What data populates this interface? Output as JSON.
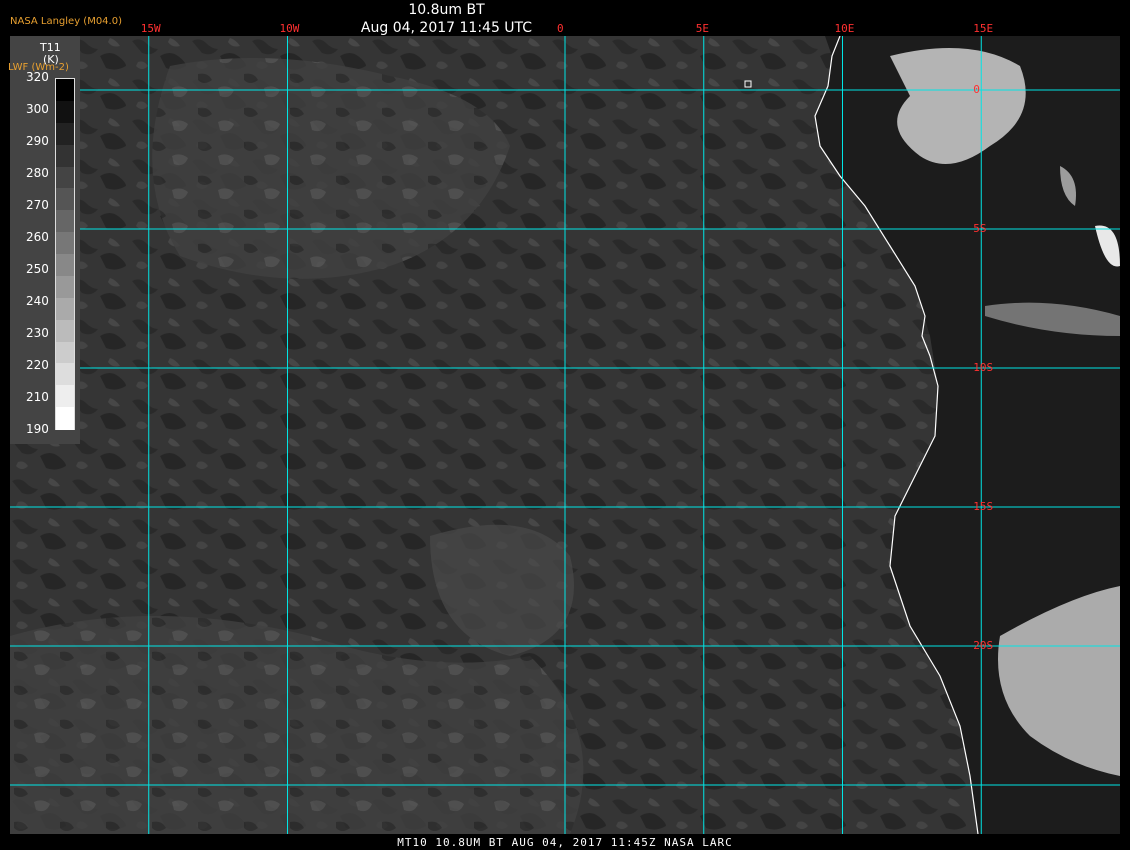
{
  "header": {
    "credit": "NASA Langley (M04.0)",
    "title": "10.8um BT",
    "subtitle": "Aug 04, 2017 11:45 UTC"
  },
  "grid": {
    "color": "#00e5e5",
    "label_color": "#ff3030",
    "longitudes": [
      {
        "label": "15W",
        "value": -15
      },
      {
        "label": "10W",
        "value": -10
      },
      {
        "label": "0",
        "value": 0
      },
      {
        "label": "5E",
        "value": 5
      },
      {
        "label": "10E",
        "value": 10
      },
      {
        "label": "15E",
        "value": 15
      }
    ],
    "latitudes": [
      {
        "label": "0",
        "value": 0
      },
      {
        "label": "5S",
        "value": -5
      },
      {
        "label": "10S",
        "value": -10
      },
      {
        "label": "15S",
        "value": -15
      },
      {
        "label": "20S",
        "value": -20
      },
      {
        "label": "",
        "value": -25
      }
    ]
  },
  "legend": {
    "variable": "T11",
    "unit": "(K)",
    "overlay": "LWF (Wm-2)",
    "ticks": [
      "320",
      "300",
      "290",
      "280",
      "270",
      "260",
      "250",
      "240",
      "230",
      "220",
      "210",
      "190"
    ],
    "colors": [
      "#000000",
      "#111111",
      "#222222",
      "#333333",
      "#444444",
      "#555555",
      "#666666",
      "#777777",
      "#888888",
      "#999999",
      "#aaaaaa",
      "#bbbbbb",
      "#cccccc",
      "#dddddd",
      "#eeeeee",
      "#ffffff"
    ]
  },
  "imagery": {
    "ocean_color": "#3a3a3a",
    "land_color": "#1e1e1e",
    "cloud_color": "#dcdcdc",
    "coastline_color": "#ffffff"
  },
  "footer": {
    "text": "MT10  10.8UM BT   AUG 04, 2017 11:45Z   NASA LARC"
  }
}
